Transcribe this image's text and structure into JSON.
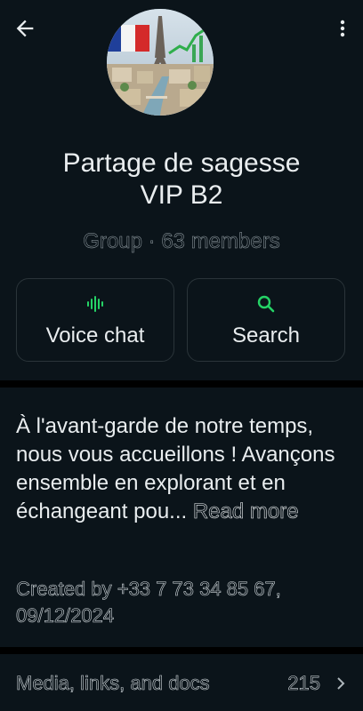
{
  "header": {
    "back_icon": "arrow-left-icon",
    "menu_icon": "more-vert-icon"
  },
  "group": {
    "title_line1": "Partage de sagesse",
    "title_line2": "VIP B2",
    "subtitle": "Group · 63 members"
  },
  "actions": {
    "voice": {
      "label": "Voice chat",
      "icon": "voice-waveform-icon",
      "color": "#25d366"
    },
    "search": {
      "label": "Search",
      "icon": "search-icon",
      "color": "#25d366"
    }
  },
  "description": {
    "text": "À l'avant-garde de notre temps, nous vous accueillons ! Avançons ensemble en explorant et en échangeant pou...",
    "read_more": "Read more",
    "created_line1": "Created by +33 7 73 34 85 67,",
    "created_line2": "09/12/2024"
  },
  "media": {
    "label": "Media, links, and docs",
    "count": "215",
    "chevron_icon": "chevron-right-icon"
  },
  "colors": {
    "background": "#0b141a",
    "accent": "#25d366",
    "divider": "#000000"
  }
}
